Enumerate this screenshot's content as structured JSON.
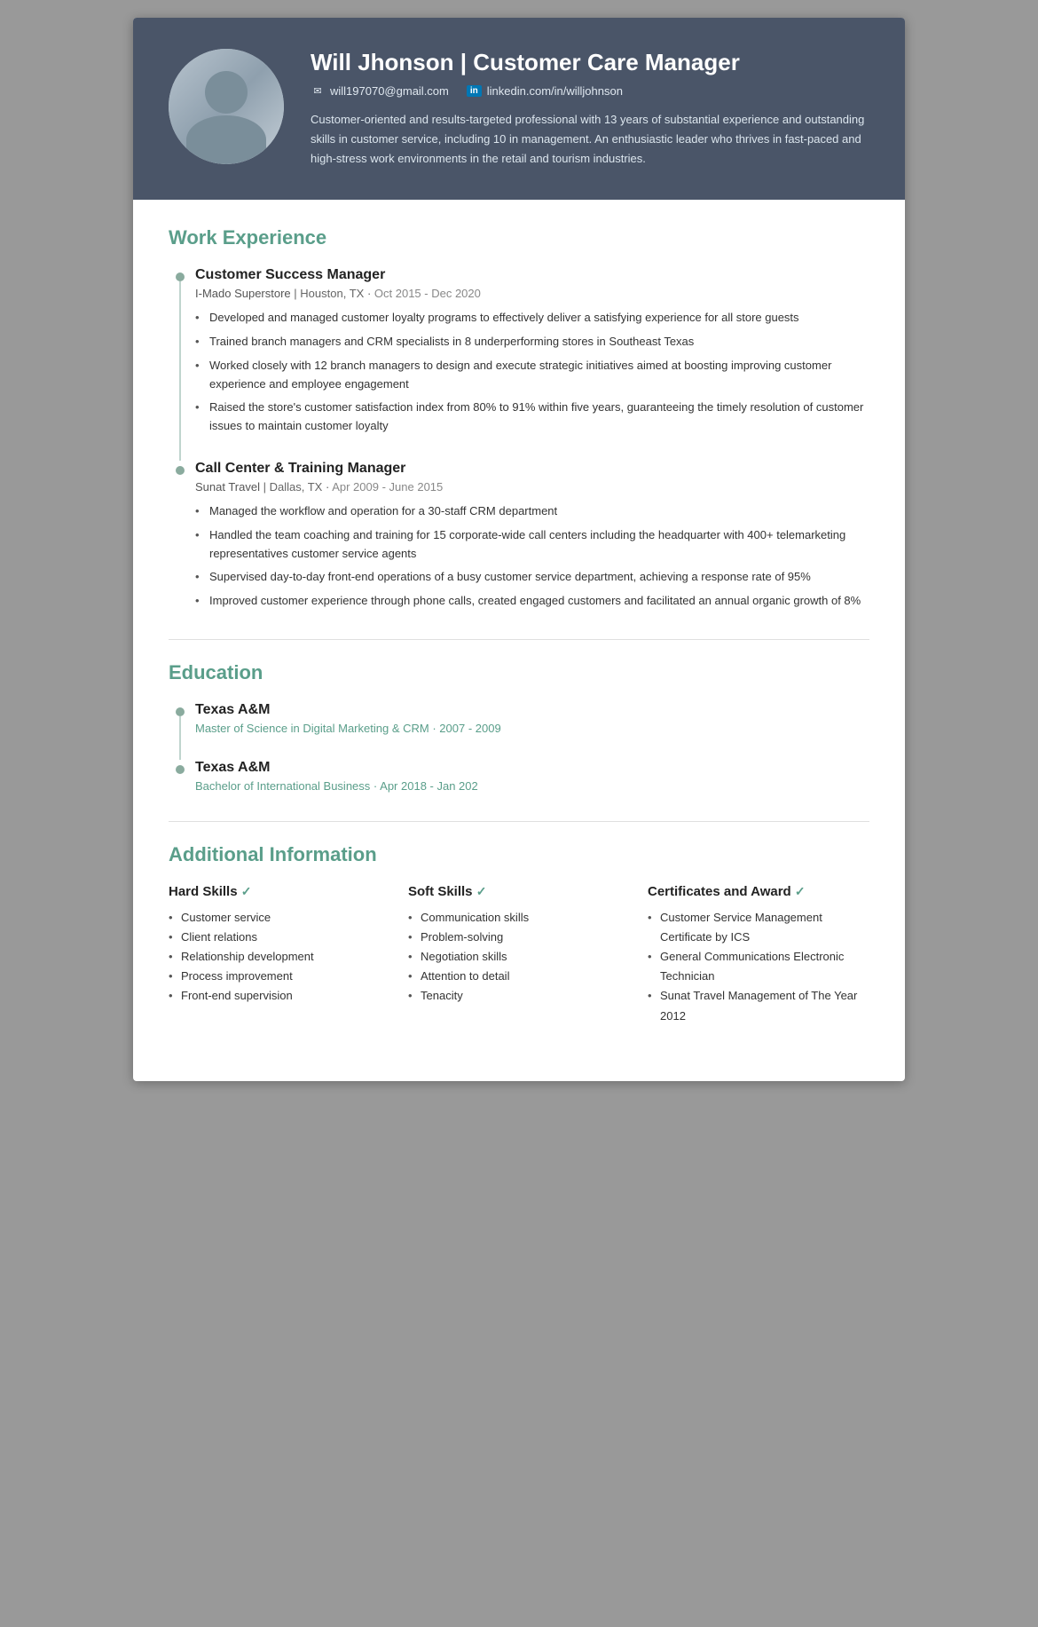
{
  "header": {
    "name": "Will Jhonson",
    "title": "Customer Care Manager",
    "email": "will197070@gmail.com",
    "linkedin": "linkedin.com/in/willjohnson",
    "summary": "Customer-oriented and results-targeted professional with 13 years of substantial experience and outstanding skills in customer service, including 10 in management. An enthusiastic leader who thrives in fast-paced and high-stress work environments in the retail and tourism industries."
  },
  "sections": {
    "work_experience_title": "Work Experience",
    "education_title": "Education",
    "additional_title": "Additional Information"
  },
  "jobs": [
    {
      "title": "Customer Success Manager",
      "company": "I-Mado Superstore",
      "location": "Houston, TX",
      "dates": "Oct 2015 - Dec 2020",
      "bullets": [
        "Developed and managed customer loyalty programs to effectively deliver a satisfying experience for all store guests",
        "Trained branch managers and CRM specialists in 8 underperforming stores in Southeast Texas",
        "Worked closely with 12 branch managers to design and execute strategic initiatives aimed at boosting improving customer experience and employee engagement",
        "Raised the store's customer satisfaction index from 80% to 91% within five years, guaranteeing the timely resolution of customer issues to maintain customer loyalty"
      ]
    },
    {
      "title": "Call Center & Training Manager",
      "company": "Sunat Travel",
      "location": "Dallas, TX",
      "dates": "Apr 2009  - June 2015",
      "bullets": [
        "Managed the workflow and operation for a 30-staff CRM department",
        "Handled the team coaching and training for 15 corporate-wide call centers including the headquarter with 400+ telemarketing representatives customer service agents",
        "Supervised day-to-day front-end operations of a busy customer service department, achieving a response rate of 95%",
        "Improved customer experience through phone calls, created engaged customers and facilitated an annual organic growth of 8%"
      ]
    }
  ],
  "education": [
    {
      "school": "Texas A&M",
      "degree": "Master of Science in Digital Marketing & CRM",
      "dates": "2007 - 2009"
    },
    {
      "school": "Texas A&M",
      "degree": "Bachelor of International Business",
      "dates": "Apr 2018 - Jan 202"
    }
  ],
  "skills": {
    "hard_title": "Hard Skills",
    "soft_title": "Soft Skills",
    "cert_title": "Certificates and Award",
    "hard": [
      "Customer service",
      "Client relations",
      "Relationship development",
      "Process improvement",
      "Front-end supervision"
    ],
    "soft": [
      "Communication skills",
      "Problem-solving",
      "Negotiation skills",
      "Attention to detail",
      "Tenacity"
    ],
    "certs": [
      "Customer Service Management Certificate by ICS",
      "General Communications Electronic Technician",
      "Sunat Travel Management of The Year 2012"
    ]
  }
}
